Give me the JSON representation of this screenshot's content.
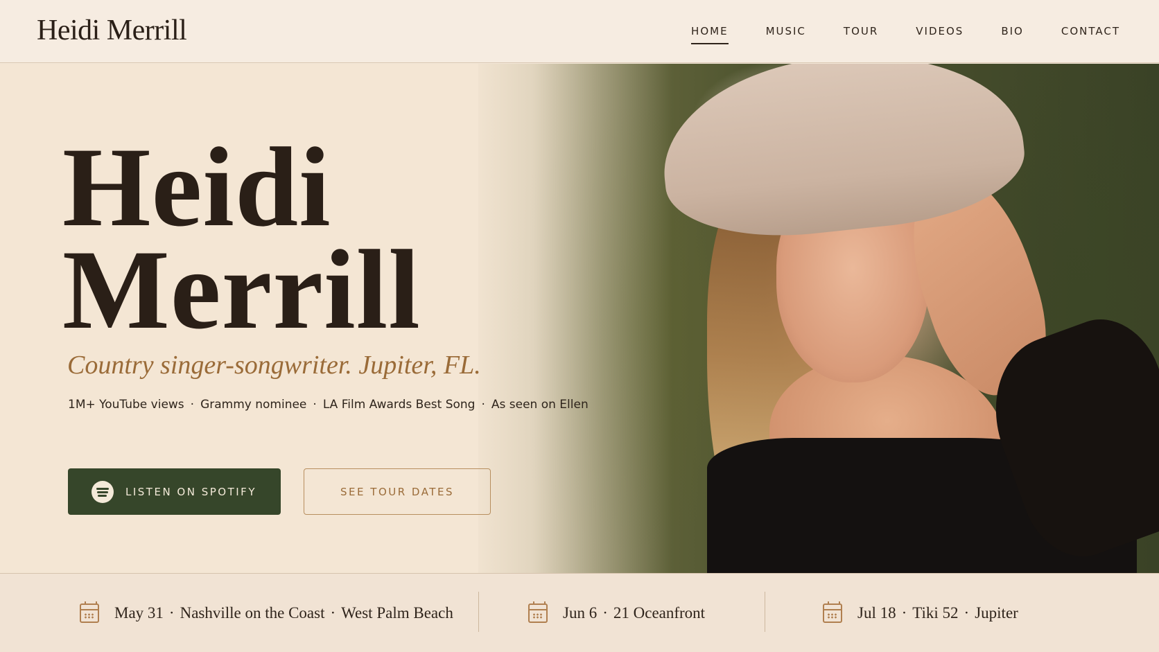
{
  "header": {
    "logo": "Heidi Merrill",
    "nav": [
      "HOME",
      "MUSIC",
      "TOUR",
      "VIDEOS",
      "BIO",
      "CONTACT"
    ],
    "active": "HOME"
  },
  "hero": {
    "title_line1": "Heidi",
    "title_line2": "Merrill",
    "tagline": "Country singer-songwriter. Jupiter, FL.",
    "credits": [
      "1M+ YouTube views",
      "Grammy nominee",
      "LA Film Awards Best Song",
      "As seen on Ellen"
    ],
    "credit_separator": "·",
    "primary_button": "LISTEN ON SPOTIFY",
    "secondary_button": "SEE TOUR DATES"
  },
  "tour": {
    "separator": "·",
    "dates": [
      {
        "date": "May 31",
        "venue": "Nashville on the Coast",
        "city": "West Palm Beach"
      },
      {
        "date": "Jun 6",
        "venue": "21 Oceanfront"
      },
      {
        "date": "Jul 18",
        "venue": "Tiki 52",
        "city": "Jupiter"
      }
    ]
  },
  "colors": {
    "background": "#f4e6d4",
    "text": "#2a1f17",
    "accent": "#9a6b38",
    "button_green": "#36462a"
  },
  "icons": [
    "spotify-icon",
    "calendar-icon"
  ]
}
